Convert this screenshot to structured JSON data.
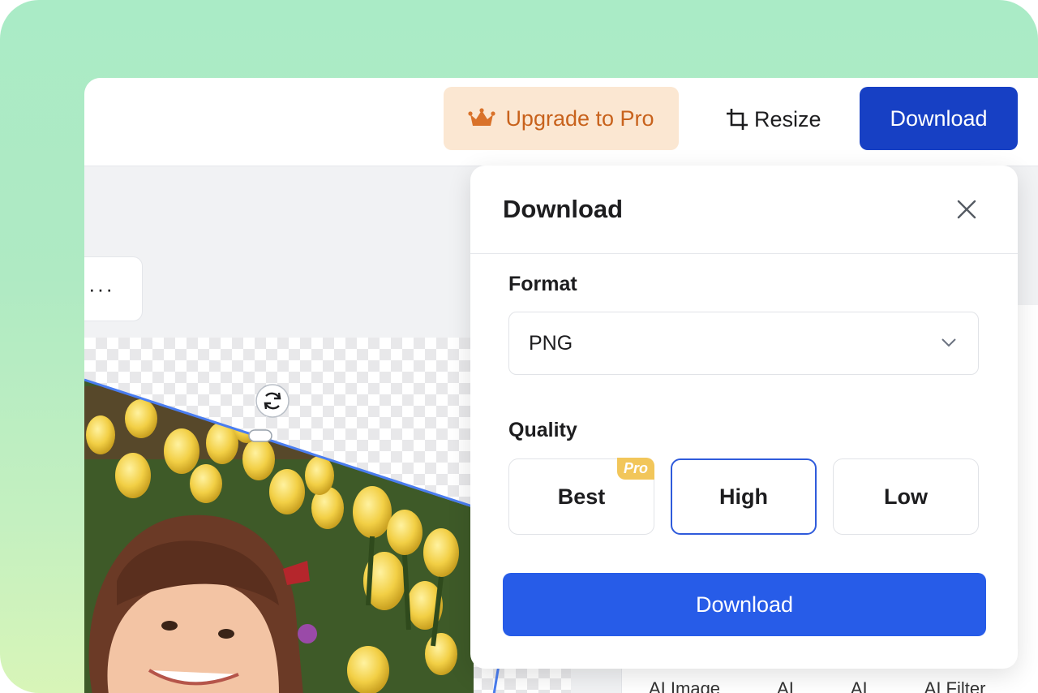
{
  "topbar": {
    "upgrade_label": "Upgrade to Pro",
    "resize_label": "Resize",
    "download_label": "Download"
  },
  "toolbar": {
    "more_label": "···"
  },
  "modal": {
    "title": "Download",
    "format": {
      "label": "Format",
      "value": "PNG"
    },
    "quality": {
      "label": "Quality",
      "options": [
        {
          "label": "Best",
          "badge": "Pro",
          "selected": false
        },
        {
          "label": "High",
          "selected": true
        },
        {
          "label": "Low",
          "selected": false
        }
      ]
    },
    "download_label": "Download"
  },
  "bottom_tabs": [
    "AI Image",
    "AI",
    "AI",
    "AI Filter"
  ],
  "colors": {
    "primary": "#275ce8",
    "primary_dark": "#1740c4",
    "upgrade_bg": "#fbe7d2",
    "upgrade_text": "#c8621c",
    "pro_badge": "#f2c65a",
    "selection_line": "#4a7df0"
  },
  "icons": {
    "upgrade": "crown-icon",
    "resize": "crop-icon",
    "close": "close-icon",
    "select": "chevron-down-icon",
    "rotate": "rotate-icon"
  }
}
